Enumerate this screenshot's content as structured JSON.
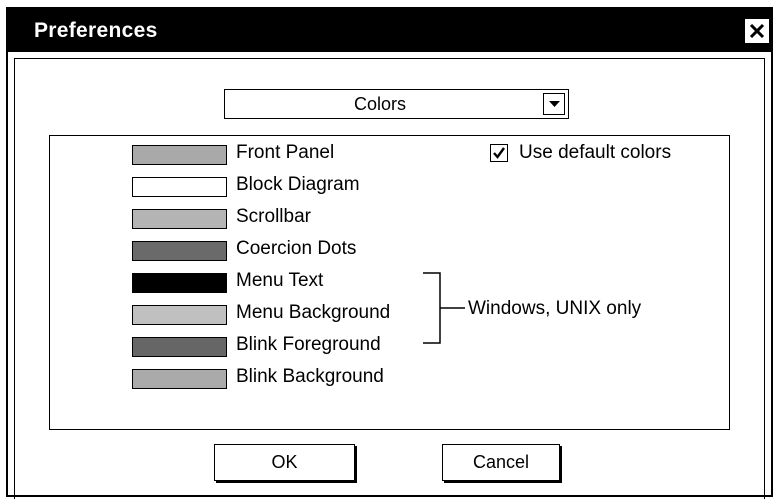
{
  "window": {
    "title": "Preferences"
  },
  "dropdown": {
    "selected": "Colors"
  },
  "checkbox": {
    "label": "Use default colors",
    "checked": true
  },
  "color_items": [
    {
      "label": "Front Panel",
      "color": "#a9a9a9"
    },
    {
      "label": "Block Diagram",
      "color": "#ffffff"
    },
    {
      "label": "Scrollbar",
      "color": "#b4b4b4"
    },
    {
      "label": "Coercion Dots",
      "color": "#6a6a6a"
    },
    {
      "label": "Menu Text",
      "color": "#000000"
    },
    {
      "label": "Menu Background",
      "color": "#c0c0c0"
    },
    {
      "label": "Blink Foreground",
      "color": "#666666"
    },
    {
      "label": "Blink Background",
      "color": "#aaaaaa"
    }
  ],
  "annotation": {
    "text": "Windows, UNIX only"
  },
  "buttons": {
    "ok": "OK",
    "cancel": "Cancel"
  }
}
